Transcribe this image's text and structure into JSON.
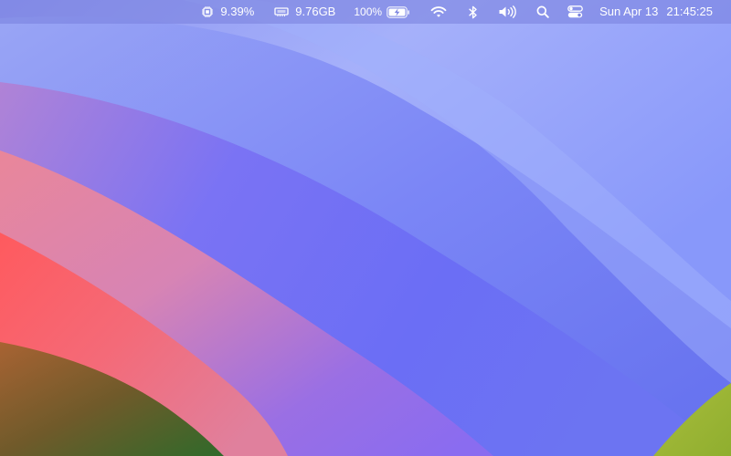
{
  "wallpaper": {
    "name": "macos-sonoma-wallpaper"
  },
  "menubar": {
    "cpu": {
      "icon": "cpu-chip-icon",
      "value": "9.39%"
    },
    "memory": {
      "icon": "memory-module-icon",
      "value": "9.76GB"
    },
    "battery": {
      "icon": "battery-charging-icon",
      "percent": "100%",
      "level": 1.0
    },
    "wifi": {
      "icon": "wifi-icon"
    },
    "bluetooth": {
      "icon": "bluetooth-icon"
    },
    "volume": {
      "icon": "speaker-volume-icon"
    },
    "spotlight": {
      "icon": "search-icon"
    },
    "control_center": {
      "icon": "control-center-toggle-icon"
    },
    "clock": {
      "date": "Sun Apr 13",
      "time": "21:45:25"
    }
  }
}
